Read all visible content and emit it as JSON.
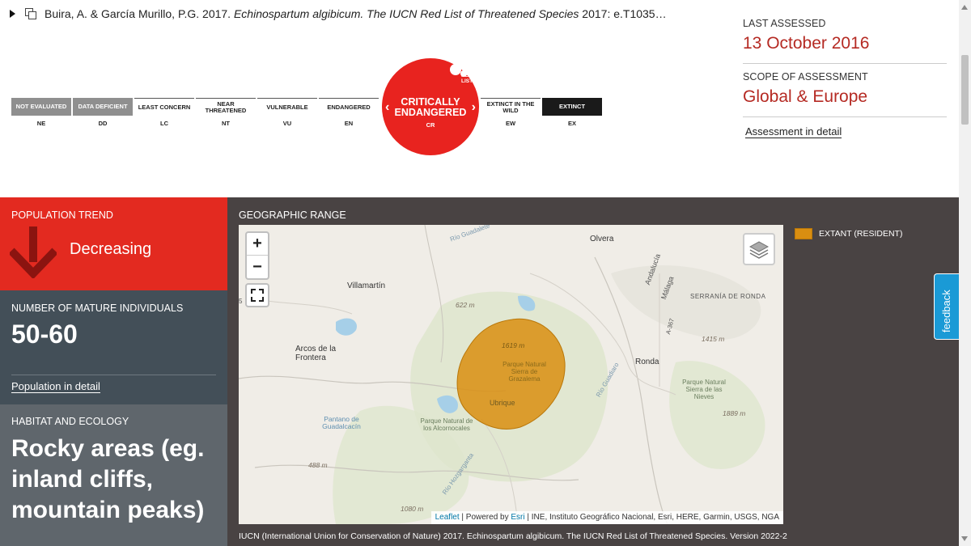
{
  "citation": {
    "authors": "Buira, A. & García Murillo, P.G. 2017.",
    "species": "Echinospartum algibicum. The IUCN Red List of Threatened Species",
    "rest": "2017: e.T1035…"
  },
  "categories": [
    {
      "label": "NOT EVALUATED",
      "code": "NE"
    },
    {
      "label": "DATA DEFICIENT",
      "code": "DD"
    },
    {
      "label": "LEAST CONCERN",
      "code": "LC"
    },
    {
      "label": "NEAR THREATENED",
      "code": "NT"
    },
    {
      "label": "VULNERABLE",
      "code": "VU"
    },
    {
      "label": "ENDANGERED",
      "code": "EN"
    },
    {
      "label": "CRITICALLY ENDANGERED",
      "code": "CR"
    },
    {
      "label": "EXTINCT IN THE WILD",
      "code": "EW"
    },
    {
      "label": "EXTINCT",
      "code": "EX"
    }
  ],
  "redlist_logo": {
    "line1": "RED",
    "line2": "LIST"
  },
  "assessment": {
    "last_assessed_label": "LAST ASSESSED",
    "last_assessed_value": "13 October 2016",
    "scope_label": "SCOPE OF ASSESSMENT",
    "scope_value": "Global & Europe",
    "detail_link": "Assessment in detail"
  },
  "population_trend": {
    "label": "POPULATION TREND",
    "value": "Decreasing"
  },
  "mature_individuals": {
    "label": "NUMBER OF MATURE INDIVIDUALS",
    "value": "50-60",
    "link": "Population in detail"
  },
  "habitat": {
    "label": "HABITAT AND ECOLOGY",
    "value": "Rocky areas (eg. inland cliffs, mountain peaks)"
  },
  "geographic_range": {
    "title": "GEOGRAPHIC RANGE",
    "legend_label": "EXTANT (RESIDENT)",
    "legend_color": "#d98e11",
    "zoom_in": "+",
    "zoom_out": "−",
    "map_labels": {
      "olvera": "Olvera",
      "villamartin": "Villamartín",
      "arcos": "Arcos de la Frontera",
      "ronda": "Ronda",
      "ubrique": "Ubrique",
      "grazalema": "Parque Natural Sierra de Grazalema",
      "alcornocales": "Parque Natural de los Alcornocales",
      "nieves": "Parque Natural Sierra de las Nieves",
      "serrania": "SERRANÍA DE RONDA",
      "pantano": "Pantano de Guadalcacín",
      "andalucia": "Andalucía",
      "malaga": "Málaga",
      "e622": "622 m",
      "e1619": "1619 m",
      "e1415": "1415 m",
      "e1889": "1889 m",
      "e488": "488 m",
      "e1080": "1080 m",
      "rio_guadalete": "Río Guadalete",
      "rio_guadiaro": "Río Guadiaro",
      "rio_hozgarganta": "Río Hozgarganta",
      "a367": "A-367",
      "five": "5"
    },
    "attribution_leaflet": "Leaflet",
    "attribution_sep": " | Powered by ",
    "attribution_esri": "Esri",
    "attribution_rest": " | INE, Instituto Geográfico Nacional, Esri, HERE, Garmin, USGS, NGA"
  },
  "caption": "IUCN (International Union for Conservation of Nature) 2017. Echinospartum algibicum. The IUCN Red List of Threatened Species. Version 2022-2",
  "feedback": "feedback",
  "colors": {
    "accent_red": "#e32a20",
    "dark_band": "#494343",
    "title_red": "#b52a23"
  }
}
